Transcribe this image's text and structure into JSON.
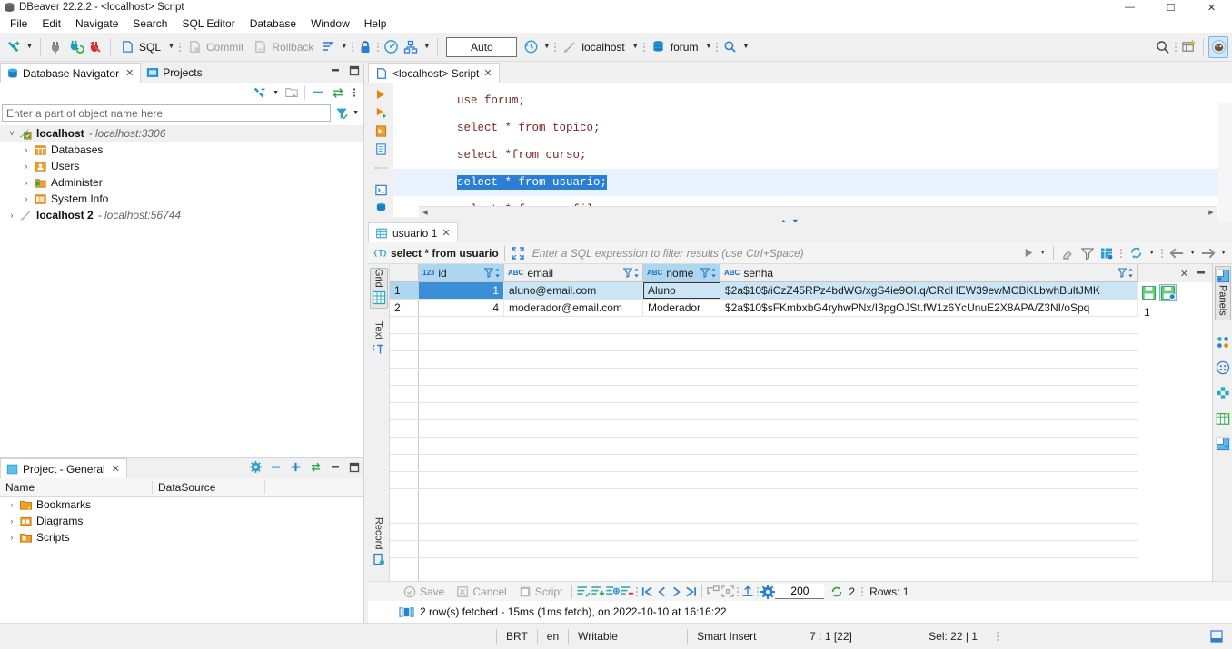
{
  "window": {
    "title": "DBeaver 22.2.2 - <localhost> Script",
    "minimize": "—",
    "maximize": "☐",
    "close": "✕"
  },
  "menubar": {
    "items": [
      "File",
      "Edit",
      "Navigate",
      "Search",
      "SQL Editor",
      "Database",
      "Window",
      "Help"
    ]
  },
  "toolbar": {
    "sql_label": "SQL",
    "commit_label": "Commit",
    "rollback_label": "Rollback",
    "auto_label": "Auto",
    "connection_label": "localhost",
    "database_label": "forum",
    "icons": [
      "new-connection-icon",
      "dropdown-arrow",
      "disconnect-icon",
      "refresh-connection-icon",
      "abort-icon",
      "sql-editor-icon",
      "commit-icon",
      "rollback-icon",
      "transaction-mode-icon",
      "lock-icon",
      "dashboard-icon",
      "schema-icon",
      "transaction-log-icon",
      "connection-icon",
      "database-icon",
      "search-icon"
    ]
  },
  "navigator": {
    "tabs": [
      {
        "label": "Database Navigator",
        "icon": "database-navigator-icon",
        "active": true,
        "closable": true
      },
      {
        "label": "Projects",
        "icon": "projects-icon",
        "active": false,
        "closable": false
      }
    ],
    "filter_placeholder": "Enter a part of object name here",
    "filter_value": "",
    "tree": [
      {
        "label": "localhost",
        "sub": "- localhost:3306",
        "icon": "db-connection-icon",
        "depth": 0,
        "expanded": true,
        "selected": true
      },
      {
        "label": "Databases",
        "sub": "",
        "icon": "databases-folder-icon",
        "depth": 1,
        "expanded": false,
        "selected": false
      },
      {
        "label": "Users",
        "sub": "",
        "icon": "users-folder-icon",
        "depth": 1,
        "expanded": false,
        "selected": false
      },
      {
        "label": "Administer",
        "sub": "",
        "icon": "administer-folder-icon",
        "depth": 1,
        "expanded": false,
        "selected": false
      },
      {
        "label": "System Info",
        "sub": "",
        "icon": "system-info-folder-icon",
        "depth": 1,
        "expanded": false,
        "selected": false
      },
      {
        "label": "localhost 2",
        "sub": "- localhost:56744",
        "icon": "db-connection-offline-icon",
        "depth": 0,
        "expanded": false,
        "selected": false
      }
    ]
  },
  "projects_panel": {
    "tab_label": "Project - General",
    "columns": [
      "Name",
      "DataSource",
      ""
    ],
    "rows": [
      {
        "name": "Bookmarks",
        "datasource": "",
        "icon": "bookmarks-folder-icon"
      },
      {
        "name": "Diagrams",
        "datasource": "",
        "icon": "diagrams-folder-icon"
      },
      {
        "name": "Scripts",
        "datasource": "",
        "icon": "scripts-folder-icon"
      }
    ]
  },
  "editor": {
    "tab_label": "<localhost> Script",
    "tab_icon": "sql-script-icon",
    "lines": [
      {
        "text": "use forum;",
        "highlighted": false
      },
      {
        "text": "select * from topico;",
        "highlighted": false
      },
      {
        "text": "select *from curso;",
        "highlighted": false
      },
      {
        "text": "select * from usuario;",
        "highlighted": true
      },
      {
        "text": "select * from perfil;",
        "highlighted": false
      }
    ],
    "gutter_icons": [
      "execute-statement-icon",
      "execute-script-icon",
      "execute-into-new-tab-icon",
      "explain-plan-icon",
      "more-icon",
      "console-icon",
      "database-icon"
    ]
  },
  "results": {
    "tab_label": "usuario 1",
    "tab_icon": "grid-icon",
    "filter_query": "select * from usuario",
    "filter_placeholder": "Enter a SQL expression to filter results (use Ctrl+Space)",
    "side_tabs": [
      "Grid",
      "Text",
      "Record"
    ],
    "columns": [
      {
        "name": "id",
        "type_badge": "123",
        "sortable": true,
        "highlighted": true
      },
      {
        "name": "email",
        "type_badge": "ABC",
        "sortable": true,
        "highlighted": false
      },
      {
        "name": "nome",
        "type_badge": "ABC",
        "sortable": true,
        "highlighted": true
      },
      {
        "name": "senha",
        "type_badge": "ABC",
        "sortable": true,
        "highlighted": false
      }
    ],
    "rows": [
      {
        "num": "1",
        "id": "1",
        "email": "aluno@email.com",
        "nome": "Aluno",
        "senha": "$2a$10$/iCzZ45RPz4bdWG/xgS4ie9OI.q/CRdHEW39ewMCBKLbwhBultJMK",
        "selected": true
      },
      {
        "num": "2",
        "id": "4",
        "email": "moderador@email.com",
        "nome": "Moderador",
        "senha": "$2a$10$sFKmbxbG4ryhwPNx/I3pgOJSt.fW1z6YcUnuE2X8APA/Z3NI/oSpq",
        "selected": false
      }
    ],
    "value_panel": {
      "value": "1",
      "tools": [
        "save-value-icon",
        "save-value-to-file-icon"
      ]
    },
    "right_rail": {
      "label": "Panels",
      "icons": [
        "panels-icon",
        "value-viewer-icon",
        "grouping-icon",
        "calc-icon",
        "metadata-icon",
        "references-icon"
      ]
    },
    "toolbar": {
      "save_label": "Save",
      "cancel_label": "Cancel",
      "script_label": "Script",
      "fetch_size": "200",
      "refresh_count": "2",
      "rows_label": "Rows: 1",
      "nav_icons": [
        "first-row-icon",
        "previous-row-icon",
        "next-row-icon",
        "last-row-icon"
      ],
      "edit_icons": [
        "edit-row-icon",
        "add-row-icon",
        "duplicate-row-icon",
        "delete-row-icon"
      ],
      "extra_icons": [
        "export-icon",
        "fit-columns-icon",
        "upload-icon",
        "settings-icon",
        "refresh-icon"
      ]
    },
    "status_message": "2 row(s) fetched - 15ms (1ms fetch), on 2022-10-10 at 16:16:22",
    "status_icon": "grid-columns-icon"
  },
  "statusbar": {
    "timezone": "BRT",
    "language": "en",
    "writable": "Writable",
    "insert_mode": "Smart Insert",
    "caret_position": "7 : 1 [22]",
    "selection": "Sel: 22 | 1"
  },
  "colors": {
    "accent_blue": "#2a7fd4",
    "header_blue": "#add7f0",
    "selection_blue": "#3b8fd6",
    "row_highlight": "#cbe5f7",
    "sql_keyword": "#7d2727",
    "panel_bg": "#f0f0f0",
    "icon_orange": "#e8820c",
    "icon_teal": "#1a9fc0"
  }
}
